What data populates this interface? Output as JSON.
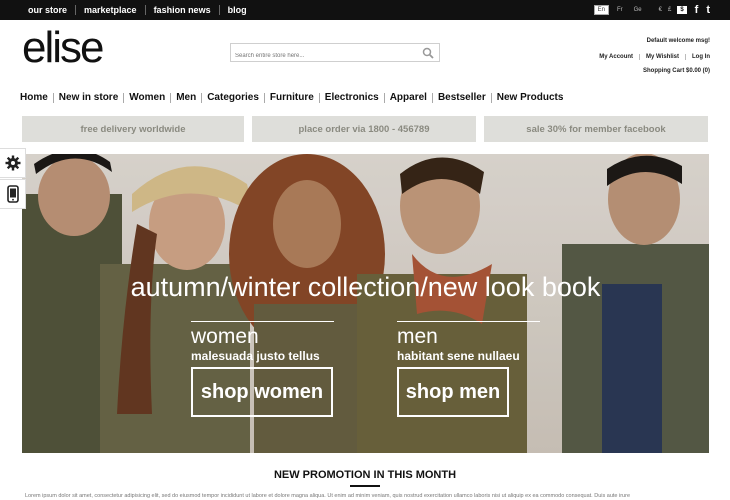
{
  "topbar": {
    "links": [
      "our store",
      "marketplace",
      "fashion news",
      "blog"
    ],
    "languages": [
      "En",
      "Fr",
      "Ge"
    ],
    "active_language": "En",
    "currencies": [
      "€",
      "£",
      "$"
    ],
    "active_currency": "$",
    "social": [
      "f",
      "t"
    ]
  },
  "header": {
    "logo": "elise",
    "search_placeholder": "Search entire store here...",
    "welcome": "Default welcome msg!",
    "account_links": [
      "My Account",
      "My Wishlist",
      "Log In"
    ],
    "cart": "Shopping Cart $0.00 (0)"
  },
  "nav": {
    "items": [
      "Home",
      "New in store",
      "Women",
      "Men",
      "Categories",
      "Furniture",
      "Electronics",
      "Apparel",
      "Bestseller",
      "New Products"
    ]
  },
  "promos": [
    "free delivery worldwide",
    "place order via 1800 - 456789",
    "sale 30% for member facebook"
  ],
  "hero": {
    "headline": "autumn/winter collection/new look book",
    "women": {
      "label": "women",
      "sub": "malesuada justo tellus",
      "button": "shop women"
    },
    "men": {
      "label": "men",
      "sub": "habitant sene nullaeu",
      "button": "shop men"
    }
  },
  "section": {
    "title": "NEW PROMOTION IN THIS MONTH",
    "text": "Lorem ipsum dolor sit amet, consectetur adipisicing elit, sed do eiusmod tempor incididunt ut labore et dolore magna aliqua. Ut enim ad minim veniam, quis nostrud exercitation ullamco laboris nisi ut aliquip ex ea commodo consequat. Duis aute irure"
  },
  "colors": {
    "topbar": "#111111",
    "promo_bg": "#dededa",
    "promo_text": "#8a8a80"
  },
  "icons": [
    "search-icon",
    "gear-icon",
    "mobile-icon",
    "facebook-icon",
    "twitter-icon"
  ]
}
